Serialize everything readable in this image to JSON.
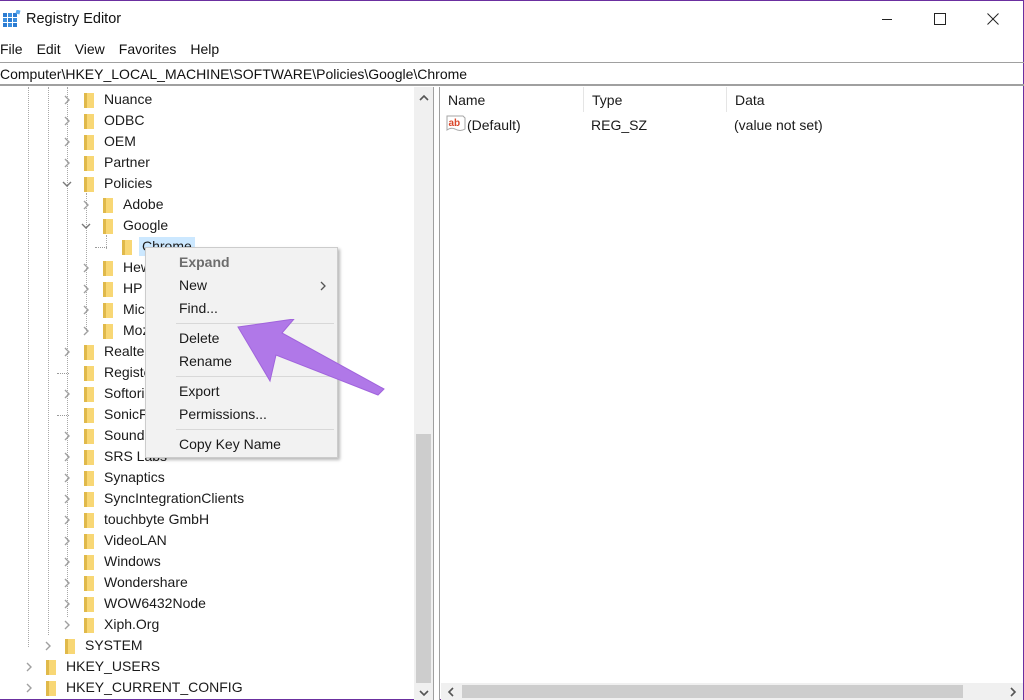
{
  "window": {
    "title": "Registry Editor",
    "minimize_label": "Minimize",
    "maximize_label": "Maximize",
    "close_label": "Close"
  },
  "menubar": {
    "items": [
      "File",
      "Edit",
      "View",
      "Favorites",
      "Help"
    ]
  },
  "address": {
    "path": "Computer\\HKEY_LOCAL_MACHINE\\SOFTWARE\\Policies\\Google\\Chrome"
  },
  "tree": {
    "nodes": [
      {
        "label": "Nuance",
        "level": 3,
        "state": "collapsed"
      },
      {
        "label": "ODBC",
        "level": 3,
        "state": "collapsed"
      },
      {
        "label": "OEM",
        "level": 3,
        "state": "collapsed"
      },
      {
        "label": "Partner",
        "level": 3,
        "state": "collapsed"
      },
      {
        "label": "Policies",
        "level": 3,
        "state": "expanded"
      },
      {
        "label": "Adobe",
        "level": 4,
        "state": "collapsed"
      },
      {
        "label": "Google",
        "level": 4,
        "state": "expanded"
      },
      {
        "label": "Chrome",
        "level": 5,
        "state": "leaf",
        "selected": true
      },
      {
        "label": "Hew",
        "level": 4,
        "state": "collapsed"
      },
      {
        "label": "HP",
        "level": 4,
        "state": "collapsed"
      },
      {
        "label": "Micr",
        "level": 4,
        "state": "collapsed"
      },
      {
        "label": "Moz",
        "level": 4,
        "state": "collapsed"
      },
      {
        "label": "Realtek",
        "level": 3,
        "state": "collapsed"
      },
      {
        "label": "Registe",
        "level": 3,
        "state": "leaf"
      },
      {
        "label": "Softorin",
        "level": 3,
        "state": "collapsed"
      },
      {
        "label": "SonicFo",
        "level": 3,
        "state": "leaf"
      },
      {
        "label": "SoundR",
        "level": 3,
        "state": "collapsed"
      },
      {
        "label": "SRS Labs",
        "level": 3,
        "state": "collapsed"
      },
      {
        "label": "Synaptics",
        "level": 3,
        "state": "collapsed"
      },
      {
        "label": "SyncIntegrationClients",
        "level": 3,
        "state": "collapsed"
      },
      {
        "label": "touchbyte GmbH",
        "level": 3,
        "state": "collapsed"
      },
      {
        "label": "VideoLAN",
        "level": 3,
        "state": "collapsed"
      },
      {
        "label": "Windows",
        "level": 3,
        "state": "collapsed"
      },
      {
        "label": "Wondershare",
        "level": 3,
        "state": "collapsed"
      },
      {
        "label": "WOW6432Node",
        "level": 3,
        "state": "collapsed"
      },
      {
        "label": "Xiph.Org",
        "level": 3,
        "state": "collapsed"
      },
      {
        "label": "SYSTEM",
        "level": 2,
        "state": "collapsed"
      },
      {
        "label": "HKEY_USERS",
        "level": 1,
        "state": "collapsed"
      },
      {
        "label": "HKEY_CURRENT_CONFIG",
        "level": 1,
        "state": "collapsed"
      }
    ]
  },
  "list": {
    "columns": [
      "Name",
      "Type",
      "Data"
    ],
    "rows": [
      {
        "icon": "string-value-icon",
        "name": "(Default)",
        "type": "REG_SZ",
        "data": "(value not set)"
      }
    ]
  },
  "context_menu": {
    "items": [
      {
        "label": "Expand",
        "bold": true
      },
      {
        "label": "New",
        "submenu": true
      },
      {
        "label": "Find..."
      },
      {
        "separator": true
      },
      {
        "label": "Delete"
      },
      {
        "label": "Rename"
      },
      {
        "separator": true
      },
      {
        "label": "Export"
      },
      {
        "label": "Permissions..."
      },
      {
        "separator": true
      },
      {
        "label": "Copy Key Name"
      }
    ]
  },
  "scroll": {
    "tree_vertical_position_fraction": 0.58,
    "list_horizontal_position_fraction": 0.0
  },
  "colors": {
    "selection": "#cce8ff",
    "folder": "#f8d775",
    "folder_dark": "#e0b94a",
    "annotation_arrow": "#b078e8",
    "window_border": "#6b2fa0"
  }
}
